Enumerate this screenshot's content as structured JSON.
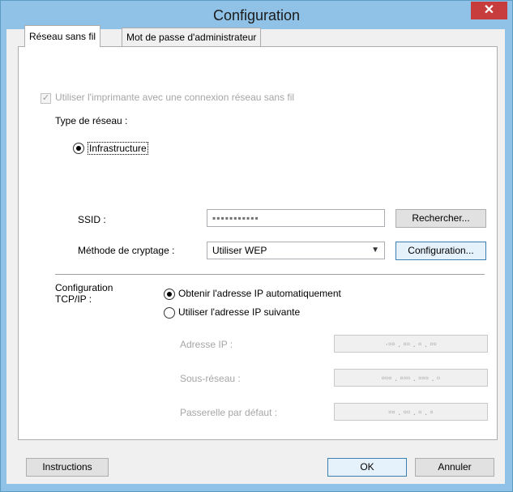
{
  "window": {
    "title": "Configuration",
    "close_label": "✕"
  },
  "tabs": [
    {
      "label": "Réseau sans fil",
      "active": true
    },
    {
      "label": "Mot de passe d'administrateur",
      "active": false
    }
  ],
  "wireless": {
    "use_wireless_label": "Utiliser l'imprimante avec une connexion réseau sans fil",
    "use_wireless_checked": true,
    "network_type_label": "Type de réseau :",
    "infrastructure_label": "Infrastructure",
    "ssid_label": "SSID :",
    "ssid_value": "▪▪▪▪▪▪▪▪▪▪▪",
    "search_button": "Rechercher...",
    "encryption_label": "Méthode de cryptage :",
    "encryption_value": "Utiliser WEP",
    "config_button": "Configuration..."
  },
  "tcpip": {
    "label_line1": "Configuration",
    "label_line2": "TCP/IP :",
    "auto_ip_label": "Obtenir l'adresse IP automatiquement",
    "manual_ip_label": "Utiliser l'adresse IP suivante",
    "ip_label": "Adresse IP :",
    "ip_value": "·▫▫ . ▫▫ . ▫ . ▫▫",
    "subnet_label": "Sous-réseau :",
    "subnet_value": "▫▫▫ . ▫▫▫ . ▫▫▫ . ▫",
    "gateway_label": "Passerelle par défaut :",
    "gateway_value": "▫▫ . ▫▫ . ▫ . ▫"
  },
  "footer": {
    "instructions_button": "Instructions",
    "ok_button": "OK",
    "cancel_button": "Annuler"
  },
  "colors": {
    "titlebar": "#8fc2e6",
    "close": "#c73d3d",
    "accent": "#3c7fb1"
  }
}
